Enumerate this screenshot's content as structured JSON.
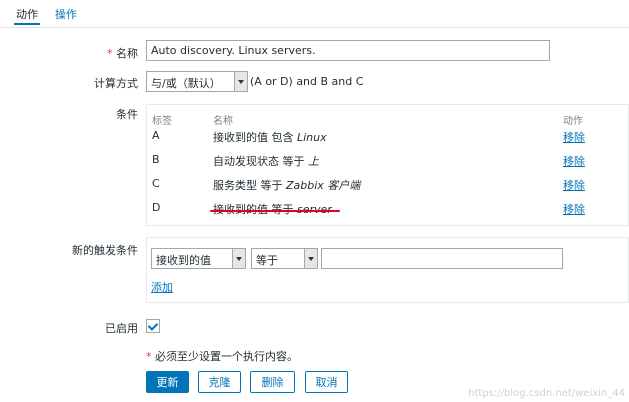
{
  "tabs": {
    "active": "动作",
    "other": "操作"
  },
  "form": {
    "name": {
      "label": "名称",
      "required_mark": "*",
      "value": "Auto discovery. Linux servers."
    },
    "calc": {
      "label": "计算方式",
      "selected": "与/或（默认）",
      "formula": "(A or D) and B and C"
    },
    "conditions": {
      "label": "条件",
      "headers": {
        "tag": "标签",
        "name": "名称",
        "action": "动作"
      },
      "rows": [
        {
          "tag": "A",
          "text": "接收到的值 包含 ",
          "value": "Linux",
          "action": "移除"
        },
        {
          "tag": "B",
          "text": "自动发现状态 等于 ",
          "value": "上",
          "action": "移除"
        },
        {
          "tag": "C",
          "text": "服务类型 等于 ",
          "value": "Zabbix 客户端",
          "action": "移除"
        },
        {
          "tag": "D",
          "text": "接收到的值 等于 ",
          "value": "server",
          "action": "移除"
        }
      ]
    },
    "new_condition": {
      "label": "新的触发条件",
      "type_selected": "接收到的值",
      "operator_selected": "等于",
      "value": "",
      "add_label": "添加"
    },
    "enabled": {
      "label": "已启用",
      "checked": true
    },
    "note": {
      "mark": "*",
      "text": " 必须至少设置一个执行内容。"
    },
    "buttons": {
      "update": "更新",
      "clone": "克隆",
      "delete": "删除",
      "cancel": "取消"
    }
  },
  "watermark": "https://blog.csdn.net/weixin_44",
  "colors": {
    "accent": "#0275b8",
    "required": "#e33734",
    "annotation": "#e3001b"
  }
}
